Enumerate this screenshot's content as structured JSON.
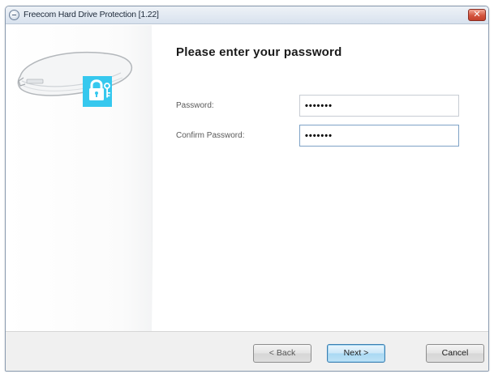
{
  "window": {
    "title": "Freecom Hard Drive Protection [1.22]",
    "close_glyph": "✕"
  },
  "content": {
    "heading": "Please enter your password",
    "password": {
      "label": "Password:",
      "value": "•••••••"
    },
    "confirm_password": {
      "label": "Confirm Password:",
      "value": "•••••••"
    }
  },
  "footer": {
    "back_label": "< Back",
    "next_label": "Next >",
    "cancel_label": "Cancel"
  },
  "icons": {
    "window_icon": "system-menu-icon",
    "illustration": "hard-drive-lock-icon"
  },
  "colors": {
    "accent_lock": "#36c8ee",
    "close_button": "#d4543e",
    "focus_border": "#3c7fb1"
  }
}
